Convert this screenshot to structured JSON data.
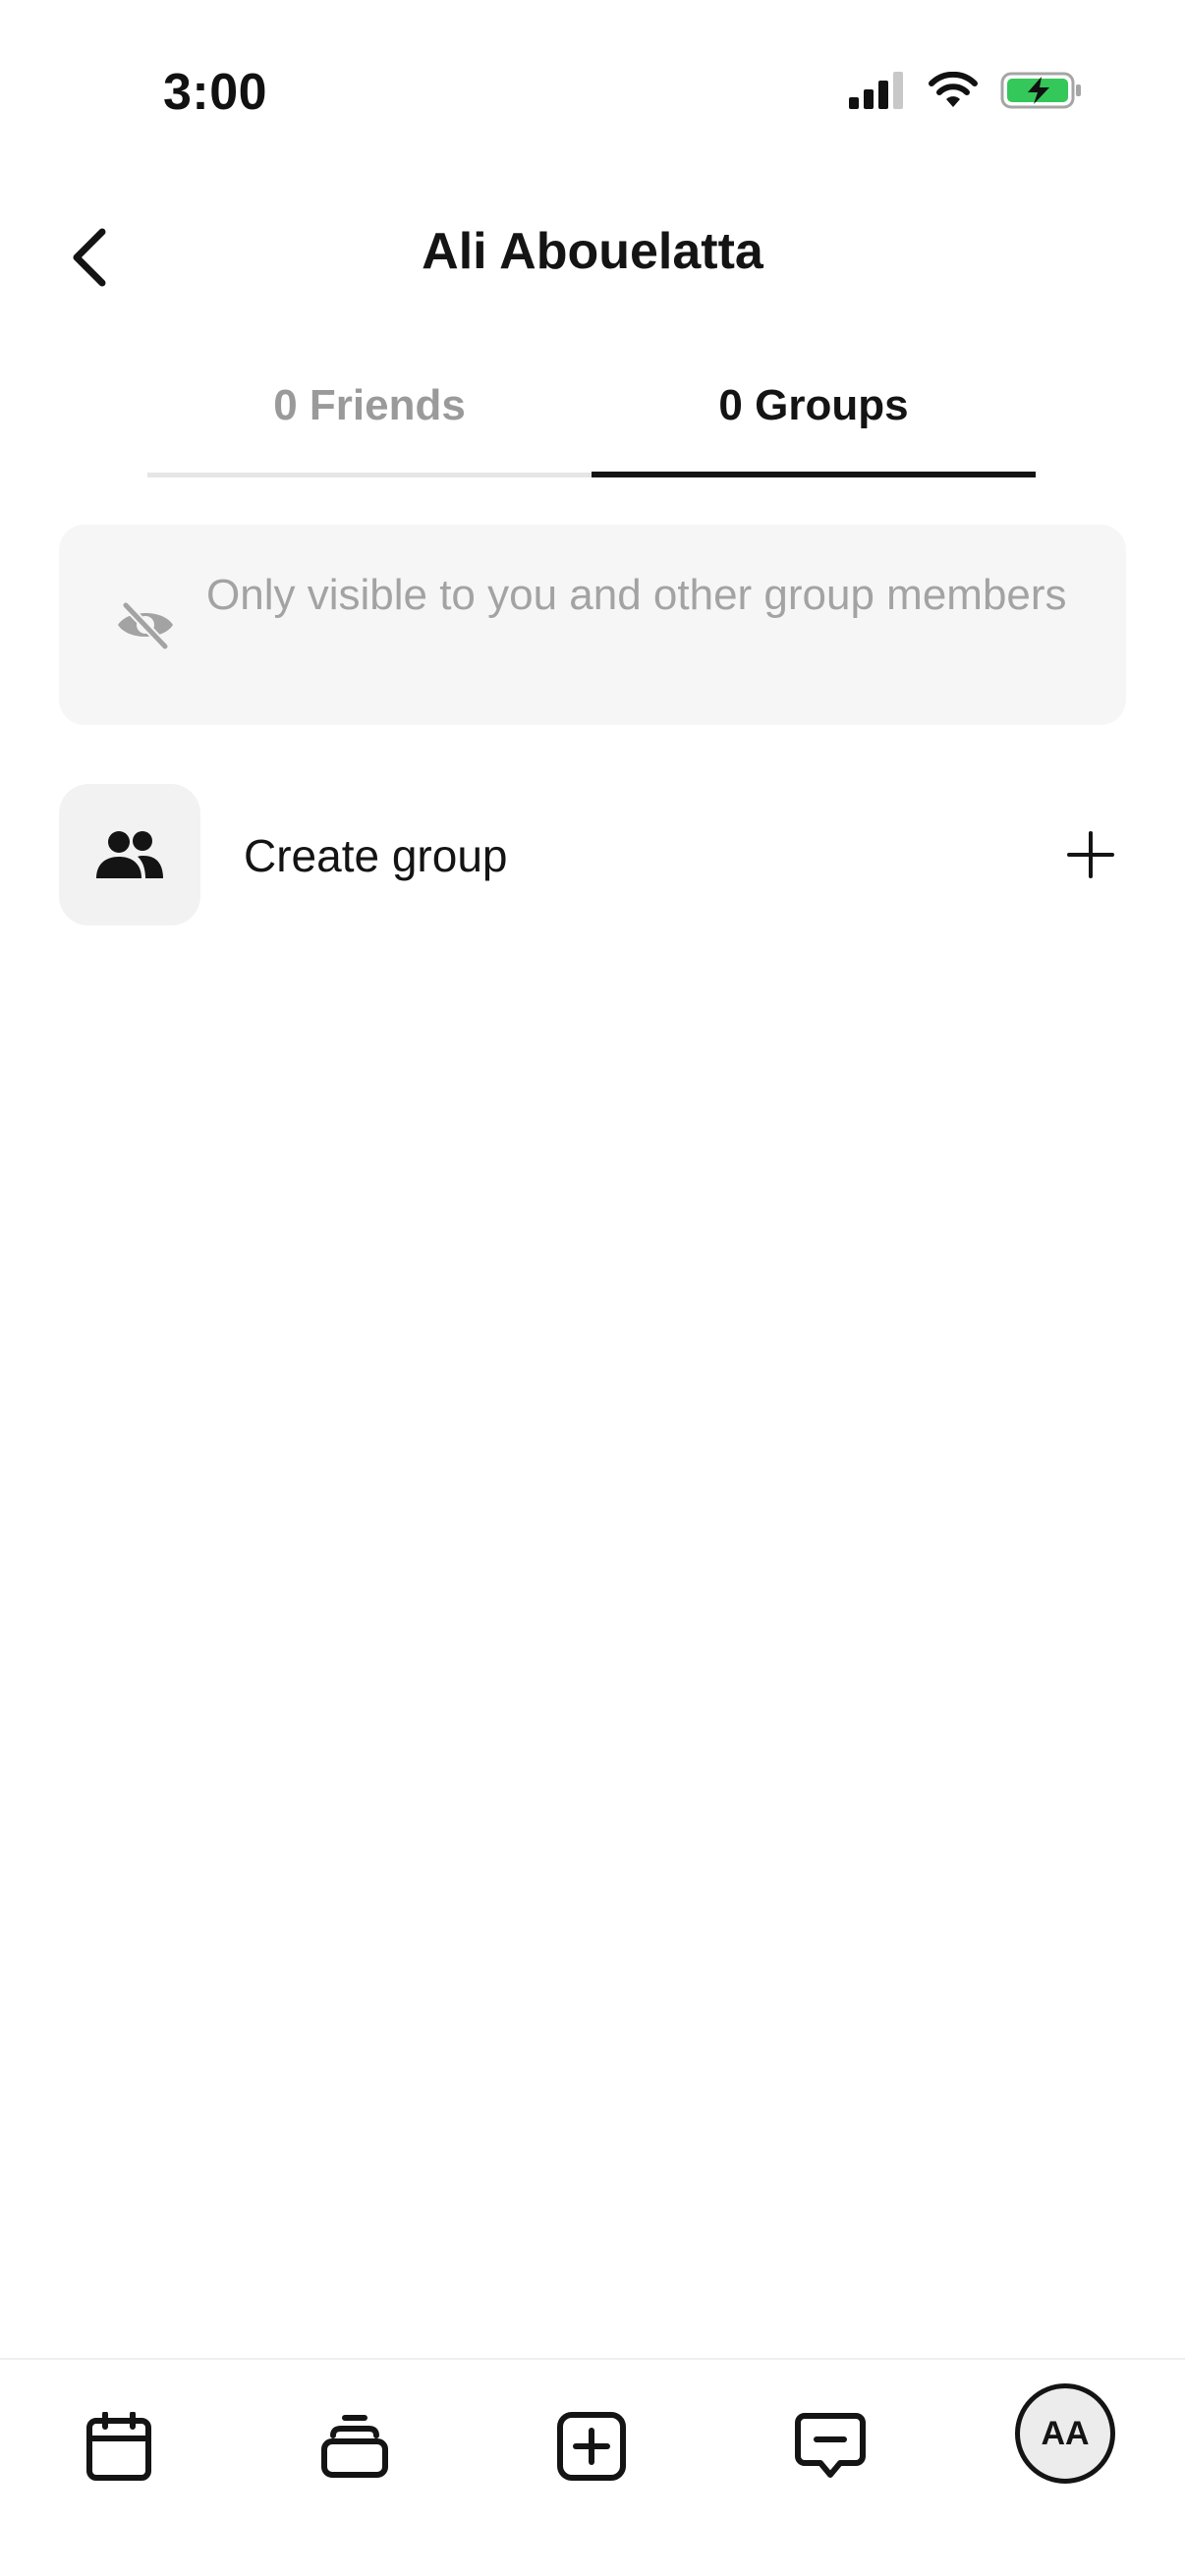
{
  "status_bar": {
    "time": "3:00",
    "icons": [
      "signal-icon",
      "wifi-icon",
      "battery-charging-icon"
    ]
  },
  "header": {
    "title": "Ali Abouelatta",
    "back_icon": "chevron-left-icon"
  },
  "tabs": [
    {
      "label": "0 Friends",
      "active": false
    },
    {
      "label": "0 Groups",
      "active": true
    }
  ],
  "notice": {
    "icon": "eye-off-icon",
    "text": "Only visible to you and other group members"
  },
  "create_group": {
    "icon": "people-icon",
    "label": "Create group",
    "action_icon": "plus-icon"
  },
  "bottom_nav": {
    "items": [
      "calendar-icon",
      "stack-icon",
      "add-square-icon",
      "message-icon"
    ],
    "avatar_initials": "AA"
  },
  "colors": {
    "primary_text": "#141414",
    "muted_text": "#9a9a9a",
    "notice_bg": "#f6f6f6",
    "battery_green": "#34c759"
  }
}
